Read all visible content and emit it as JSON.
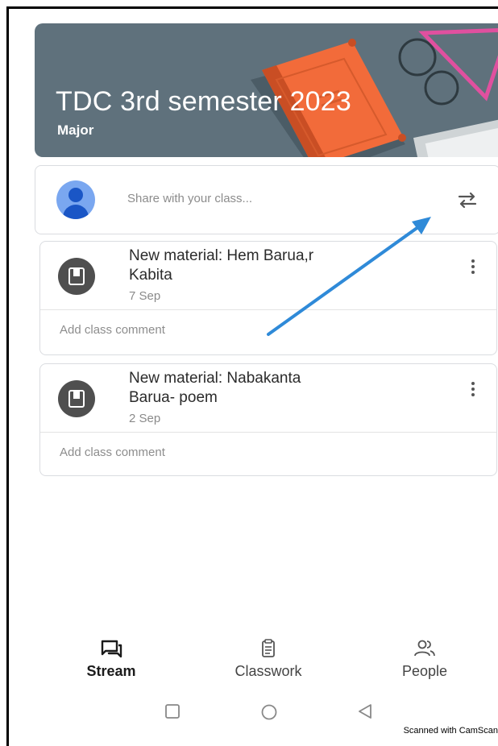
{
  "class": {
    "title": "TDC 3rd semester 2023",
    "section": "Major"
  },
  "share": {
    "placeholder": "Share with your class..."
  },
  "posts": [
    {
      "title_line1": "New material: Hem Barua,r",
      "title_line2": "Kabita",
      "date": "7 Sep",
      "comment_prompt": "Add class comment"
    },
    {
      "title_line1": "New material: Nabakanta",
      "title_line2": "Barua- poem",
      "date": "2 Sep",
      "comment_prompt": "Add class comment"
    }
  ],
  "nav": {
    "items": [
      {
        "label": "Stream",
        "icon": "stream-icon",
        "active": true
      },
      {
        "label": "Classwork",
        "icon": "classwork-icon",
        "active": false
      },
      {
        "label": "People",
        "icon": "people-icon",
        "active": false
      }
    ]
  },
  "system_nav": [
    "recents-icon",
    "home-icon",
    "back-icon"
  ],
  "footer": {
    "watermark": "Scanned with CamScan"
  },
  "colors": {
    "banner": "#5f717c",
    "book": "#f26b3a",
    "glasses": "#e0509f",
    "avatar": "#7aa7f0",
    "annotation_arrow": "#2f8ad8"
  }
}
